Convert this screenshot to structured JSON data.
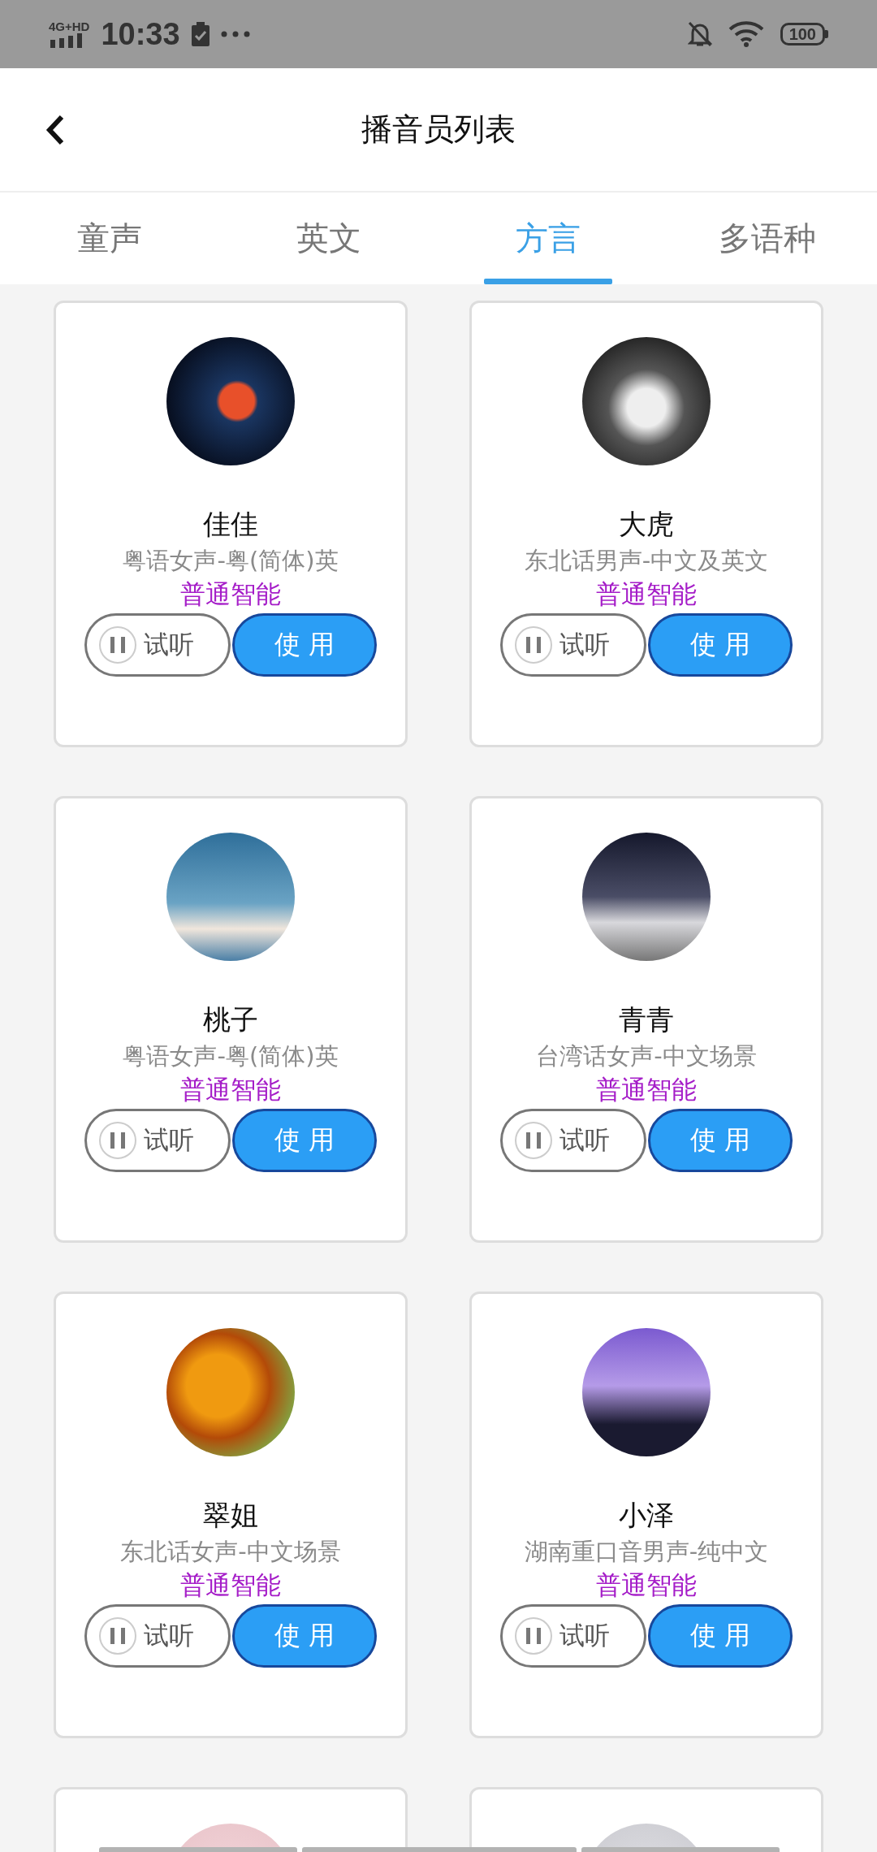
{
  "status_bar": {
    "network": "4G+HD",
    "time": "10:33",
    "battery": "100"
  },
  "header": {
    "title": "播音员列表"
  },
  "tabs": [
    {
      "label": "童声",
      "selected": false
    },
    {
      "label": "英文",
      "selected": false
    },
    {
      "label": "方言",
      "selected": true
    },
    {
      "label": "多语种",
      "selected": false
    }
  ],
  "cards": [
    {
      "kind": "full",
      "name": "佳佳",
      "description": "粤语女声-粤(简体)英",
      "tag": "普通智能",
      "listen_label": "试听",
      "use_label": "使 用"
    },
    {
      "kind": "full",
      "name": "大虎",
      "description": "东北话男声-中文及英文",
      "tag": "普通智能",
      "listen_label": "试听",
      "use_label": "使 用"
    },
    {
      "kind": "full",
      "name": "桃子",
      "description": "粤语女声-粤(简体)英",
      "tag": "普通智能",
      "listen_label": "试听",
      "use_label": "使 用"
    },
    {
      "kind": "full",
      "name": "青青",
      "description": "台湾话女声-中文场景",
      "tag": "普通智能",
      "listen_label": "试听",
      "use_label": "使 用"
    },
    {
      "kind": "full",
      "name": "翠姐",
      "description": "东北话女声-中文场景",
      "tag": "普通智能",
      "listen_label": "试听",
      "use_label": "使 用"
    },
    {
      "kind": "full",
      "name": "小泽",
      "description": "湖南重口音男声-纯中文",
      "tag": "普通智能",
      "listen_label": "试听",
      "use_label": "使 用"
    },
    {
      "kind": "partial"
    },
    {
      "kind": "partial"
    }
  ]
}
